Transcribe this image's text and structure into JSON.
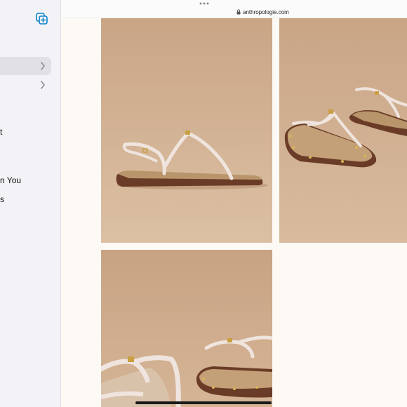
{
  "browser": {
    "url": "anthropologie.com"
  },
  "sidebar": {
    "items": [
      {
        "label": "t"
      },
      {
        "label": "n You"
      },
      {
        "label": "s"
      }
    ]
  },
  "colors": {
    "accent": "#0a84c8",
    "sidebar_bg": "#f2f2f7",
    "photo_bg": "#d3b394",
    "sole": "#6a3c27",
    "strap": "#efe4de"
  },
  "gallery": {
    "images": [
      {
        "name": "sandal-side-view"
      },
      {
        "name": "sandal-pair-angled"
      },
      {
        "name": "sandal-pair-closeup"
      }
    ]
  }
}
